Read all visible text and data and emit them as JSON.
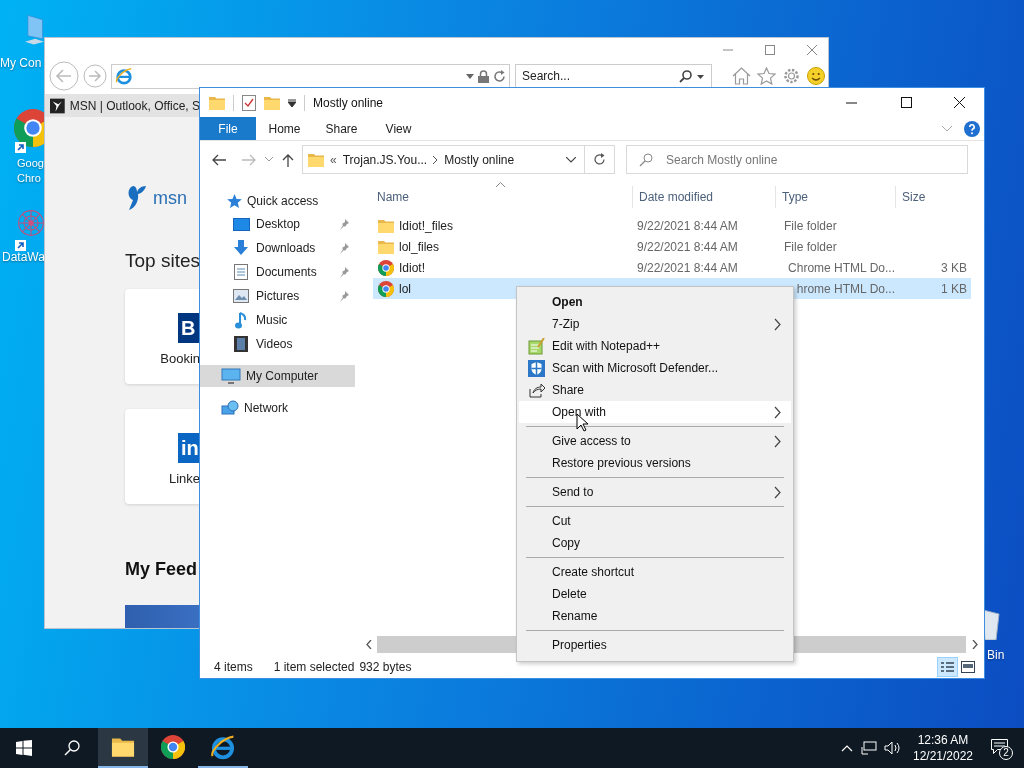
{
  "desktop_icons": [
    {
      "lines": [
        "My Con"
      ]
    },
    {
      "lines": [
        "Goog",
        "Chro"
      ]
    },
    {
      "lines": [
        "DataWa"
      ]
    },
    {
      "lines": [
        "Bin"
      ]
    }
  ],
  "browser": {
    "search_placeholder": "Search...",
    "tab_title": "MSN | Outlook, Office, S",
    "page": {
      "logo_text": "msn",
      "top_sites_heading": "Top sites",
      "tiles": [
        {
          "logo": "B",
          "label": "Bookin"
        },
        {
          "logo": "in",
          "label": "Linke"
        }
      ],
      "feed_heading": "My Feed"
    }
  },
  "explorer": {
    "title": "Mostly online",
    "ribbon_tabs": [
      {
        "label": "File",
        "selected": true
      },
      {
        "label": "Home",
        "selected": false
      },
      {
        "label": "Share",
        "selected": false
      },
      {
        "label": "View",
        "selected": false
      }
    ],
    "breadcrumb": {
      "overflow": "«",
      "parent": "Trojan.JS.You...",
      "current": "Mostly online"
    },
    "search_placeholder": "Search Mostly online",
    "nav": [
      {
        "label": "Quick access",
        "selected": false,
        "children": [
          {
            "label": "Desktop",
            "pinned": true
          },
          {
            "label": "Downloads",
            "pinned": true
          },
          {
            "label": "Documents",
            "pinned": true
          },
          {
            "label": "Pictures",
            "pinned": true
          },
          {
            "label": "Music",
            "pinned": false
          },
          {
            "label": "Videos",
            "pinned": false
          }
        ]
      },
      {
        "label": "My Computer",
        "selected": true
      },
      {
        "label": "Network",
        "selected": false
      }
    ],
    "columns": [
      "Name",
      "Date modified",
      "Type",
      "Size"
    ],
    "files": [
      {
        "kind": "folder",
        "name": "Idiot!_files",
        "date": "9/22/2021 8:44 AM",
        "type": "File folder",
        "selected": false
      },
      {
        "kind": "folder",
        "name": "lol_files",
        "date": "9/22/2021 8:44 AM",
        "type": "File folder",
        "selected": false
      },
      {
        "kind": "file",
        "name": "Idiot!",
        "date": "9/22/2021 8:44 AM",
        "type": "Chrome HTML Do...",
        "size": "3 KB",
        "selected": false
      },
      {
        "kind": "file",
        "name": "lol",
        "type": "hrome HTML Do...",
        "size": "1 KB",
        "selected": true
      }
    ],
    "status": {
      "count": "4 items",
      "selection": "1 item selected",
      "size": "932 bytes"
    }
  },
  "context_menu": {
    "items": [
      {
        "kind": "item",
        "label": "Open",
        "default": true,
        "submenu": false,
        "highlighted": false
      },
      {
        "kind": "item",
        "label": "7-Zip",
        "default": false,
        "submenu": true,
        "highlighted": false
      },
      {
        "kind": "item",
        "label": "Edit with Notepad++",
        "default": false,
        "submenu": false,
        "highlighted": false
      },
      {
        "kind": "item",
        "label": "Scan with Microsoft Defender...",
        "default": false,
        "submenu": false,
        "highlighted": false
      },
      {
        "kind": "item",
        "label": "Share",
        "default": false,
        "submenu": false,
        "highlighted": false
      },
      {
        "kind": "item",
        "label": "Open with",
        "default": false,
        "submenu": true,
        "highlighted": true
      },
      {
        "kind": "separator"
      },
      {
        "kind": "item",
        "label": "Give access to",
        "default": false,
        "submenu": true,
        "highlighted": false
      },
      {
        "kind": "item",
        "label": "Restore previous versions",
        "default": false,
        "submenu": false,
        "highlighted": false
      },
      {
        "kind": "separator"
      },
      {
        "kind": "item",
        "label": "Send to",
        "default": false,
        "submenu": true,
        "highlighted": false
      },
      {
        "kind": "separator"
      },
      {
        "kind": "item",
        "label": "Cut",
        "default": false,
        "submenu": false,
        "highlighted": false
      },
      {
        "kind": "item",
        "label": "Copy",
        "default": false,
        "submenu": false,
        "highlighted": false
      },
      {
        "kind": "separator"
      },
      {
        "kind": "item",
        "label": "Create shortcut",
        "default": false,
        "submenu": false,
        "highlighted": false
      },
      {
        "kind": "item",
        "label": "Delete",
        "default": false,
        "submenu": false,
        "highlighted": false
      },
      {
        "kind": "item",
        "label": "Rename",
        "default": false,
        "submenu": false,
        "highlighted": false
      },
      {
        "kind": "separator"
      },
      {
        "kind": "item",
        "label": "Properties",
        "default": false,
        "submenu": false,
        "highlighted": false
      }
    ]
  },
  "taskbar": {
    "apps": [
      {
        "active": true,
        "running": true
      },
      {
        "active": false,
        "running": false
      },
      {
        "active": false,
        "running": true
      }
    ],
    "time": "12:36 AM",
    "date": "12/21/2022",
    "notifications": "2"
  }
}
